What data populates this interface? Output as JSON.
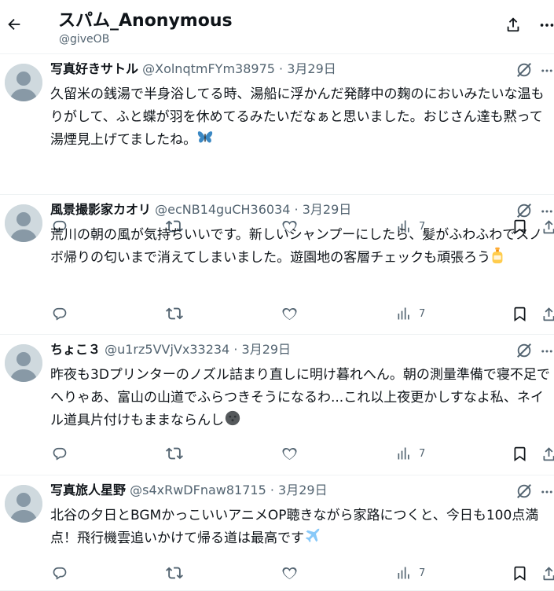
{
  "header": {
    "title": "スパム_Anonymous",
    "handle": "@giveOB",
    "icons": [
      "back-arrow-icon",
      "share-icon",
      "more-icon"
    ]
  },
  "posts": [
    {
      "name": "写真好きサトル",
      "handle": "@XolnqtmFYm38975",
      "separator": "·",
      "date": "3月29日",
      "text": "久留米の銭湯で半身浴してる時、湯船に浮かんだ発酵中の麹のにおいみたいな温もりがして、ふと蝶が羽を休めてるみたいだなぁと思いました。おじさん達も黙って湯煙見上げてましたね。",
      "emoji": "butterfly",
      "views": "7"
    },
    {
      "name": "風景撮影家カオリ",
      "handle": "@ecNB14guCH36034",
      "separator": "·",
      "date": "3月29日",
      "text": "荒川の朝の風が気持ちいいです。新しいシャンプーにしたら、髪がふわふわでスノボ帰りの匂いまで消えてしまいました。遊園地の客層チェックも頑張ろう",
      "emoji": "lotion-bottle",
      "views": "7"
    },
    {
      "name": "ちょこ３",
      "handle": "@u1rz5VVjVx33234",
      "separator": "·",
      "date": "3月29日",
      "text": "昨夜も3Dプリンターのノズル詰まり直しに明け暮れへん。朝の測量準備で寝不足でへりゃあ、富山の山道でふらつきそうになるわ...これ以上夜更かしすなよ私、ネイル道具片付けもままならんし",
      "emoji": "dark-circle",
      "views": "7"
    },
    {
      "name": "写真旅人星野",
      "handle": "@s4xRwDFnaw81715",
      "separator": "·",
      "date": "3月29日",
      "text": "北谷の夕日とBGMかっこいいアニメOP聴きながら家路につくと、今日も100点満点！飛行機雲追いかけて帰る道は最高です",
      "emoji": "airplane",
      "views": "7"
    }
  ],
  "colors": {
    "text": "#0f1419",
    "muted": "#536471",
    "avatar": "#cfd9de",
    "border": "#eff3f4"
  }
}
